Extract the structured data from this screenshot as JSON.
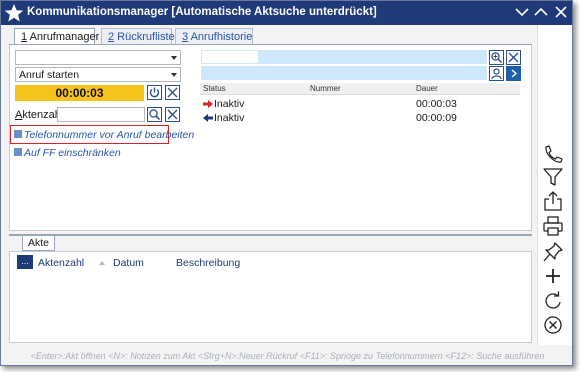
{
  "window": {
    "title": "Kommunikationsmanager [Automatische Aktsuche unterdrückt]",
    "icons": [
      "star-logo-icon",
      "chevron-down-icon",
      "chevron-up-icon",
      "close-icon"
    ]
  },
  "tabs": [
    {
      "key": "1",
      "label": " Anrufmanager",
      "active": true
    },
    {
      "key": "2",
      "label": " Rückrufliste",
      "active": false
    },
    {
      "key": "3",
      "label": " Anrufhistorie",
      "active": false
    }
  ],
  "left": {
    "combo1_value": "",
    "combo2_value": "Anruf starten",
    "timer": "00:00:03",
    "akten_label_underlined": "A",
    "akten_label_rest": "ktenzahl:",
    "akten_value": "",
    "link1": "Telefonnummer vor Anruf bearbeiten",
    "link2": "Auf FF einschränken"
  },
  "table": {
    "columns": [
      "Status",
      "Nummer",
      "Dauer"
    ],
    "rows": [
      {
        "direction": "outgoing",
        "status": "Inaktiv",
        "nummer": "",
        "dauer": "00:00:03"
      },
      {
        "direction": "incoming",
        "status": "Inaktiv",
        "nummer": "",
        "dauer": "00:00:09"
      }
    ]
  },
  "bottom": {
    "tab_label": "Akte",
    "dots_label": "...",
    "columns": [
      "Aktenzahl",
      "Datum",
      "Beschreibung"
    ]
  },
  "sidebar_icons": [
    "phone-icon",
    "filter-icon",
    "share-icon",
    "print-icon",
    "pin-icon",
    "add-icon",
    "refresh-icon",
    "cancel-icon"
  ],
  "statusbar": "<Enter>:Akt öffnen <N>: Notizen zum Akt <Strg+N>:Neuer Rückruf <F11>: Sprioge zu Telefonnummern <F12>: Suche ausführen",
  "colors": {
    "titlebar": "#1e3a78",
    "timer": "#f6c31a",
    "search_bg": "#cfe8fb",
    "highlight": "#d8242a",
    "link": "#2a55a8"
  }
}
